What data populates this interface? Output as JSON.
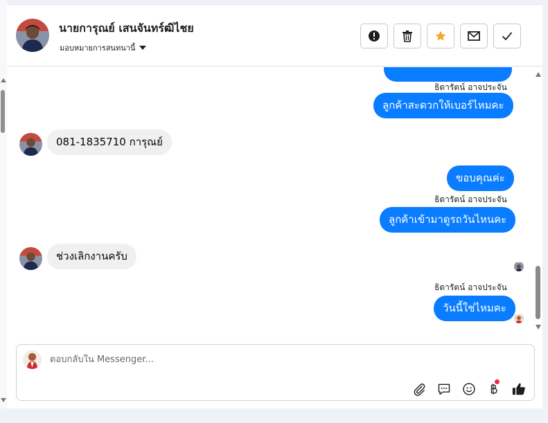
{
  "header": {
    "contact_name": "นายการุณย์ เสนจันทร์ฒิไชย",
    "assign_label": "มอบหมายการสนทนานี้",
    "actions": [
      {
        "name": "spam",
        "icon": "exclamation-circle-icon"
      },
      {
        "name": "delete",
        "icon": "trash-icon"
      },
      {
        "name": "follow-up",
        "icon": "star-icon",
        "color": "#f5a623"
      },
      {
        "name": "mark-unread",
        "icon": "envelope-icon"
      },
      {
        "name": "done",
        "icon": "check-icon"
      }
    ]
  },
  "messages": {
    "sender_name": "ธิดารัตน์ อาจประจัน",
    "out_1": "ลูกค้าสะดวกให้เบอร์ไหมคะ",
    "in_1": "081-1835710  การุณย์",
    "out_2": "ขอบคุณค่ะ",
    "out_3": "ลูกค้าเข้ามาดูรถวันไหนคะ",
    "in_2": "ช่วงเลิกงานครับ",
    "out_4": "วันนี้ใช่ไหมคะ"
  },
  "composer": {
    "placeholder": "ตอบกลับใน Messenger...",
    "tools": [
      "paperclip-icon",
      "chat-bubble-icon",
      "smiley-icon",
      "baht-icon",
      "thumbs-up-icon"
    ]
  },
  "colors": {
    "outgoing_bubble": "#0a7cff",
    "incoming_bubble": "#f0f0f0",
    "accent_star": "#f5a623",
    "notification_dot": "#f02849"
  }
}
